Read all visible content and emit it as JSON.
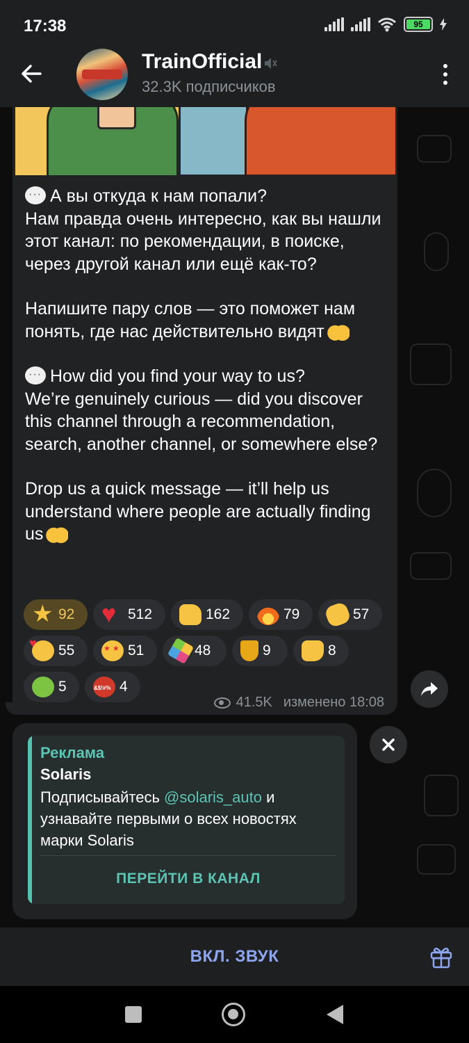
{
  "status_bar": {
    "time": "17:38",
    "battery": "95"
  },
  "header": {
    "channel_name": "TrainOfficial",
    "subscribers": "32.3K подписчиков",
    "icons": [
      "back-arrow-icon",
      "muted-speaker-icon",
      "more-vertical-icon"
    ]
  },
  "message": {
    "paragraphs": [
      {
        "emoji": "speech-bubble",
        "text": "А вы откуда к нам попали?\nНам правда очень интересно, как вы нашли этот канал: по рекомендации, в поиске, через другой канал или ещё как-то?"
      },
      {
        "emoji": null,
        "text": "Напишите пару слов — это поможет нам понять, где нас действительно видят",
        "trailing_emoji": "raising-hands"
      },
      {
        "emoji": "speech-bubble",
        "text": "How did you find your way to us?\nWe’re genuinely curious — did you discover this channel through a recommendation, search, another channel, or somewhere else?"
      },
      {
        "emoji": null,
        "text": "Drop us a quick message — it’ll help us understand where people are actually finding us",
        "trailing_emoji": "raising-hands"
      }
    ],
    "reactions": [
      {
        "emoji": "star",
        "count": "92",
        "active": true
      },
      {
        "emoji": "red-heart",
        "count": "512"
      },
      {
        "emoji": "thumbs-up",
        "count": "162"
      },
      {
        "emoji": "fire",
        "count": "79"
      },
      {
        "emoji": "clapping-hands",
        "count": "57"
      },
      {
        "emoji": "smiling-face-with-hearts",
        "count": "55"
      },
      {
        "emoji": "star-struck",
        "count": "51"
      },
      {
        "emoji": "party-popper",
        "count": "48"
      },
      {
        "emoji": "trophy",
        "count": "9"
      },
      {
        "emoji": "thumbs-down",
        "count": "8"
      },
      {
        "emoji": "vomiting-face",
        "count": "5"
      },
      {
        "emoji": "cursing-face",
        "count": "4"
      }
    ],
    "views": "41.5K",
    "edited": "изменено 18:08"
  },
  "ad": {
    "label": "Реклама",
    "title": "Solaris",
    "body_before": "Подписывайтесь ",
    "mention": "@solaris_auto",
    "body_after": " и узнавайте первыми о всех новостях марки Solaris",
    "button": "ПЕРЕЙТИ В КАНАЛ"
  },
  "bottom_bar": {
    "sound_button": "ВКЛ. ЗВУК"
  },
  "colors": {
    "accent": "#5cc4b3",
    "sound": "#8ea6f0",
    "bubble": "#212224",
    "reaction_active": "#564823"
  }
}
